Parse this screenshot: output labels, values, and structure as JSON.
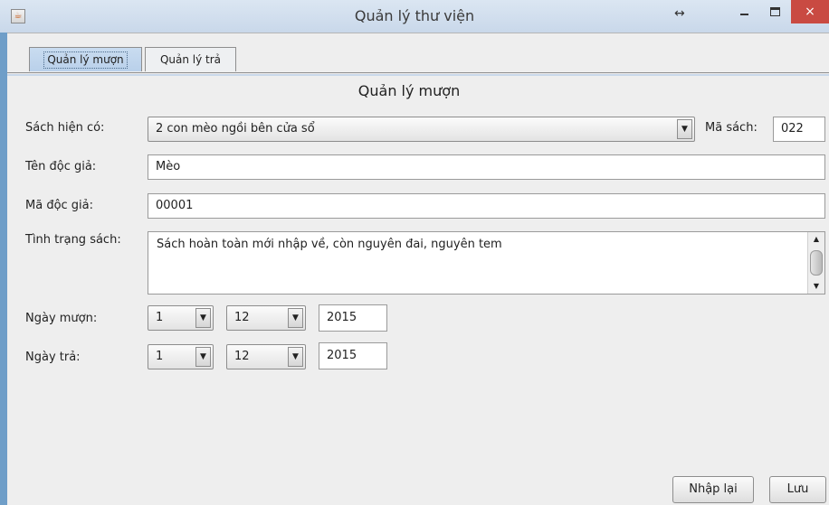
{
  "window": {
    "title": "Quản lý thư viện",
    "app_icon": "java-cup-icon",
    "resize_glyph": "↔",
    "close_glyph": "×"
  },
  "tabs": [
    {
      "label": "Quản lý mượn",
      "selected": true
    },
    {
      "label": "Quản lý trả",
      "selected": false
    }
  ],
  "form": {
    "heading": "Quản lý mượn",
    "book_label": "Sách hiện có:",
    "book_value": "2 con mèo ngồi bên cửa sổ",
    "book_code_label": "Mã sách:",
    "book_code_value": "022",
    "reader_name_label": "Tên độc giả:",
    "reader_name_value": "Mèo",
    "reader_id_label": "Mã độc giả:",
    "reader_id_value": "00001",
    "condition_label": "Tình trạng sách:",
    "condition_value": "Sách hoàn toàn mới nhập về, còn nguyên đai, nguyên tem",
    "borrow_date_label": "Ngày mượn:",
    "borrow_day": "1",
    "borrow_month": "12",
    "borrow_year": "2015",
    "return_date_label": "Ngày trả:",
    "return_day": "1",
    "return_month": "12",
    "return_year": "2015"
  },
  "buttons": {
    "reset": "Nhập lại",
    "save": "Lưu"
  },
  "colors": {
    "titlebar": "#c9d8ea",
    "close_button": "#c94a42",
    "panel": "#eeeeee",
    "desktop": "#6f9ec8"
  }
}
